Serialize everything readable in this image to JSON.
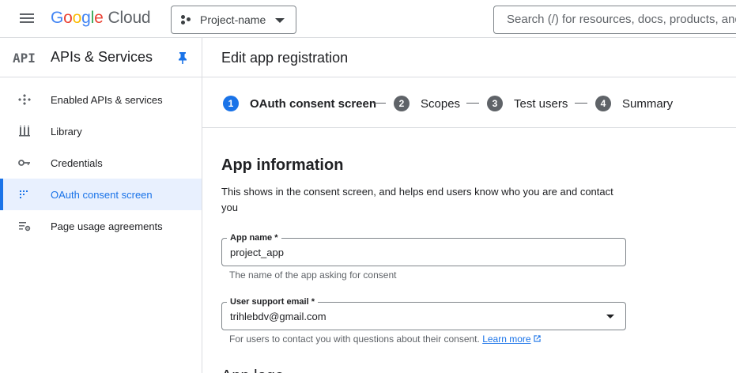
{
  "header": {
    "logo_google": [
      "G",
      "o",
      "o",
      "g",
      "l",
      "e"
    ],
    "logo_product": "Cloud",
    "project": "Project-name",
    "search_placeholder": "Search (/) for resources, docs, products, and more"
  },
  "sidebar": {
    "badge": "API",
    "title": "APIs & Services",
    "items": [
      {
        "label": "Enabled APIs & services",
        "icon": "apis-hub-icon",
        "active": false
      },
      {
        "label": "Library",
        "icon": "library-icon",
        "active": false
      },
      {
        "label": "Credentials",
        "icon": "key-icon",
        "active": false
      },
      {
        "label": "OAuth consent screen",
        "icon": "consent-grid-icon",
        "active": true
      },
      {
        "label": "Page usage agreements",
        "icon": "settings-list-icon",
        "active": false
      }
    ]
  },
  "main": {
    "title": "Edit app registration",
    "steps": [
      {
        "num": "1",
        "label": "OAuth consent screen",
        "active": true
      },
      {
        "num": "2",
        "label": "Scopes",
        "active": false
      },
      {
        "num": "3",
        "label": "Test users",
        "active": false
      },
      {
        "num": "4",
        "label": "Summary",
        "active": false
      }
    ],
    "section_title": "App information",
    "section_desc": "This shows in the consent screen, and helps end users know who you are and contact you",
    "app_name": {
      "label": "App name *",
      "value": "project_app",
      "hint": "The name of the app asking for consent"
    },
    "support_email": {
      "label": "User support email *",
      "value": "trihlebdv@gmail.com",
      "hint": "For users to contact you with questions about their consent.",
      "link": "Learn more"
    },
    "next_section_partial": "App logo"
  },
  "colors": {
    "accent": "#1a73e8",
    "active_bg": "#e8f0fe",
    "step_inactive": "#5f6368"
  }
}
